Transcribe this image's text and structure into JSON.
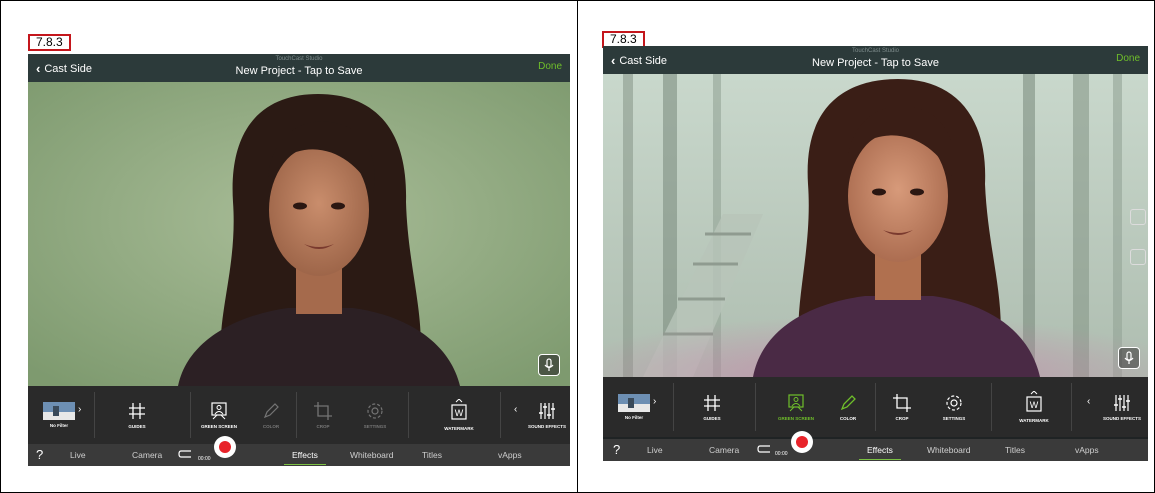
{
  "left_panel": {
    "version": "7.8.3",
    "app": {
      "back_label": "Cast Side",
      "brand": "TouchCast Studio",
      "title": "New Project - Tap to Save",
      "done_label": "Done"
    },
    "tools": {
      "filter": "No Filter",
      "guides": "GUIDES",
      "green_screen": "GREEN SCREEN",
      "color": "COLOR",
      "crop": "CROP",
      "settings": "SETTINGS",
      "watermark": "WATERMARK",
      "sound_effects": "SOUND EFFECTS"
    },
    "bottom": {
      "help": "?",
      "live": "Live",
      "camera": "Camera",
      "timer": "00:00",
      "tabs": [
        "Effects",
        "Whiteboard",
        "Titles",
        "vApps"
      ],
      "active_tab": "Effects"
    },
    "icons": [
      "chevron-left-icon",
      "grid-icon",
      "green-screen-icon",
      "pencil-icon",
      "crop-icon",
      "gear-icon",
      "watermark-icon",
      "sliders-icon",
      "undo-icon",
      "record-icon",
      "mic-icon"
    ]
  },
  "right_panel": {
    "version": "7.8.3",
    "app": {
      "back_label": "Cast Side",
      "brand": "TouchCast Studio",
      "title": "New Project - Tap to Save",
      "done_label": "Done"
    },
    "tools": {
      "filter": "No Filter",
      "guides": "GUIDES",
      "green_screen": "GREEN SCREEN",
      "color": "COLOR",
      "crop": "CROP",
      "settings": "SETTINGS",
      "watermark": "WATERMARK",
      "sound_effects": "SOUND EFFECTS"
    },
    "bottom": {
      "help": "?",
      "live": "Live",
      "camera": "Camera",
      "timer": "00:00",
      "tabs": [
        "Effects",
        "Whiteboard",
        "Titles",
        "vApps"
      ],
      "active_tab": "Effects"
    }
  },
  "colors": {
    "accent_green": "#6fbf2a",
    "record_red": "#e8232a",
    "version_border": "#c4161c",
    "topbar": "#2c3a3a",
    "toolbar": "#2a2a2a"
  }
}
